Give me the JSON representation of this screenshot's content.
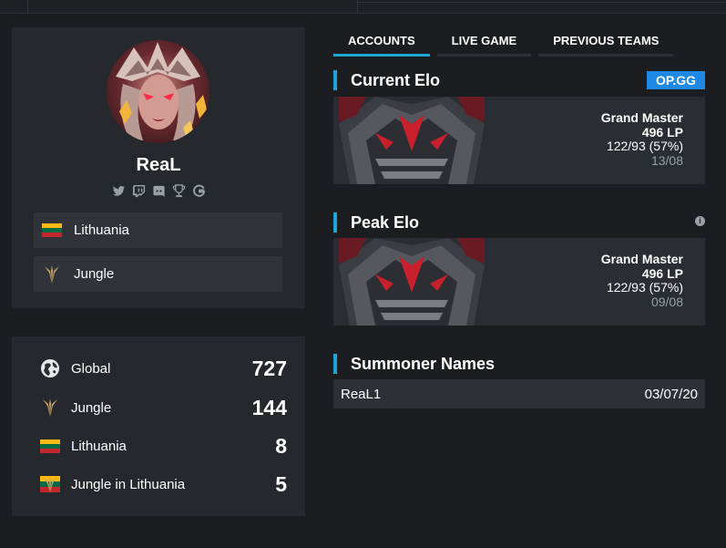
{
  "profile": {
    "username": "ReaL",
    "social_icons": [
      "twitter-icon",
      "twitch-icon",
      "discord-icon",
      "trophy-icon",
      "gamepedia-icon"
    ],
    "country": "Lithuania",
    "role": "Jungle"
  },
  "rankings": [
    {
      "label": "Global",
      "value": "727",
      "icon": "globe-icon"
    },
    {
      "label": "Jungle",
      "value": "144",
      "icon": "jungle-role-icon"
    },
    {
      "label": "Lithuania",
      "value": "8",
      "icon": "lithuania-flag-icon"
    },
    {
      "label": "Jungle in Lithuania",
      "value": "5",
      "icon": "jungle-lithuania-icon"
    }
  ],
  "tabs": [
    {
      "label": "ACCOUNTS",
      "active": true
    },
    {
      "label": "LIVE GAME",
      "active": false
    },
    {
      "label": "PREVIOUS TEAMS",
      "active": false
    }
  ],
  "current_elo": {
    "title": "Current Elo",
    "badge": "OP.GG",
    "tier": "Grand Master",
    "lp": "496 LP",
    "record": "122/93 (57%)",
    "date": "13/08"
  },
  "peak_elo": {
    "title": "Peak Elo",
    "tier": "Grand Master",
    "lp": "496 LP",
    "record": "122/93 (57%)",
    "date": "09/08"
  },
  "summoner_names": {
    "title": "Summoner Names",
    "rows": [
      {
        "name": "ReaL1",
        "date": "03/07/20"
      }
    ]
  },
  "colors": {
    "accent": "#1ea7d6",
    "opgg": "#1e88e5",
    "panel": "#25282d",
    "background": "#1b1d21"
  }
}
